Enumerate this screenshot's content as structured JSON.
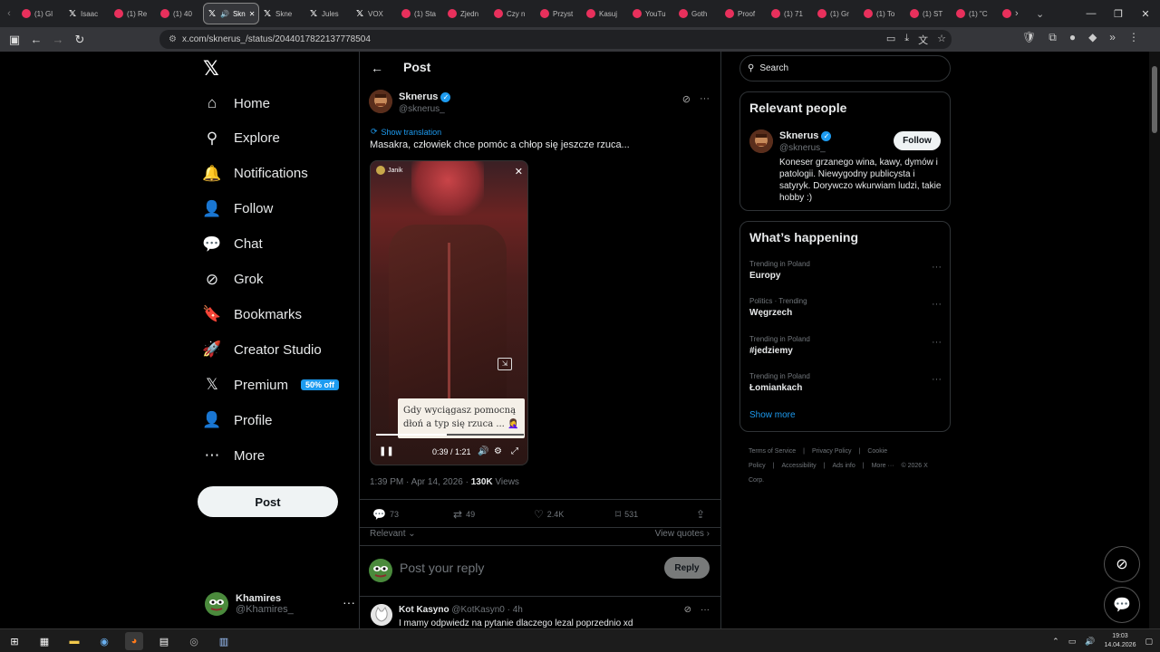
{
  "browser": {
    "tabs": [
      {
        "label": "(1) Gl",
        "type": "yt"
      },
      {
        "label": "Isaac",
        "type": "x"
      },
      {
        "label": "(1) Re",
        "type": "yt"
      },
      {
        "label": "(1) 40",
        "type": "yt"
      },
      {
        "label": "Skn",
        "type": "x",
        "active": true
      },
      {
        "label": "Skne",
        "type": "x"
      },
      {
        "label": "Jules",
        "type": "x"
      },
      {
        "label": "VOX",
        "type": "x"
      },
      {
        "label": "(1) Sta",
        "type": "yt"
      },
      {
        "label": "Zjedn",
        "type": "yt"
      },
      {
        "label": "Czy n",
        "type": "yt"
      },
      {
        "label": "Przyst",
        "type": "yt"
      },
      {
        "label": "Kasuj",
        "type": "yt"
      },
      {
        "label": "YouTu",
        "type": "yt"
      },
      {
        "label": "Goth",
        "type": "yt"
      },
      {
        "label": "Proof",
        "type": "yt"
      },
      {
        "label": "(1) 71",
        "type": "yt"
      },
      {
        "label": "(1) Gr",
        "type": "yt"
      },
      {
        "label": "(1) To",
        "type": "yt"
      },
      {
        "label": "(1) ST",
        "type": "yt"
      },
      {
        "label": "(1) \"C",
        "type": "yt"
      },
      {
        "label": "",
        "type": "yt"
      }
    ],
    "url": "x.com/sknerus_/status/2044017822137778504"
  },
  "nav": {
    "items": [
      {
        "label": "Home",
        "icon": "home-icon",
        "glyph": "⌂"
      },
      {
        "label": "Explore",
        "icon": "search-icon",
        "glyph": "⚲"
      },
      {
        "label": "Notifications",
        "icon": "bell-icon",
        "glyph": "🔔"
      },
      {
        "label": "Follow",
        "icon": "add-person-icon",
        "glyph": "👤"
      },
      {
        "label": "Chat",
        "icon": "chat-icon",
        "glyph": "💬"
      },
      {
        "label": "Grok",
        "icon": "grok-icon",
        "glyph": "⊘"
      },
      {
        "label": "Bookmarks",
        "icon": "bookmark-icon",
        "glyph": "🔖"
      },
      {
        "label": "Creator Studio",
        "icon": "rocket-icon",
        "glyph": "🚀"
      },
      {
        "label": "Premium",
        "icon": "x-icon",
        "glyph": "𝕏"
      },
      {
        "label": "Profile",
        "icon": "person-icon",
        "glyph": "👤"
      },
      {
        "label": "More",
        "icon": "more-circle-icon",
        "glyph": "⋯"
      }
    ],
    "premium_badge": "50% off",
    "post_label": "Post"
  },
  "account": {
    "name": "Khamires",
    "handle": "@Khamires_"
  },
  "main": {
    "title": "Post",
    "tweet": {
      "author": "Sknerus",
      "handle": "@sknerus_",
      "show_translation": "Show translation",
      "text": "Masakra, człowiek chce pomóc a chłop się jeszcze rzuca...",
      "video": {
        "user": "Janik",
        "caption_line1": "Gdy wyciągasz pomocną",
        "caption_line2": "dłoń a typ się rzuca ... 🤦‍♀️",
        "time": "0:39 / 1:21",
        "progress": 0.48
      },
      "timestamp": "1:39 PM · Apr 14, 2026 · ",
      "views_count": "130K",
      "views_label": " Views",
      "replies": "73",
      "reposts": "49",
      "likes": "2.4K",
      "bookmarks": "531"
    },
    "sort_label": "Relevant",
    "view_quotes": "View quotes",
    "reply_placeholder": "Post your reply",
    "reply_button": "Reply",
    "first_reply": {
      "name": "Kot Kasyno",
      "handle_time": " @KotKasyn0 · 4h",
      "text": "I mamy odpwiedz na pytanie dlaczego lezal poprzednio xd"
    }
  },
  "right": {
    "search_placeholder": "Search",
    "relevant_people_title": "Relevant people",
    "person": {
      "name": "Sknerus",
      "handle": "@sknerus_",
      "follow_label": "Follow",
      "bio": "Koneser grzanego wina, kawy, dymów i patologii. Niewygodny publicysta i satyryk. Dorywczo wkurwiam ludzi, takie hobby :)"
    },
    "happening_title": "What’s happening",
    "trends": [
      {
        "category": "Trending in Poland",
        "name": "Europy"
      },
      {
        "category": "Politics · Trending",
        "name": "Węgrzech"
      },
      {
        "category": "Trending in Poland",
        "name": "#jedziemy"
      },
      {
        "category": "Trending in Poland",
        "name": "Łomiankach"
      }
    ],
    "show_more": "Show more",
    "footer": [
      "Terms of Service",
      "|",
      "Privacy Policy",
      "|",
      "Cookie Policy",
      "|",
      "Accessibility",
      "|",
      "Ads info",
      "|",
      "More ···",
      "© 2026 X Corp."
    ]
  },
  "taskbar": {
    "time": "19:03",
    "date": "14.04.2026"
  }
}
